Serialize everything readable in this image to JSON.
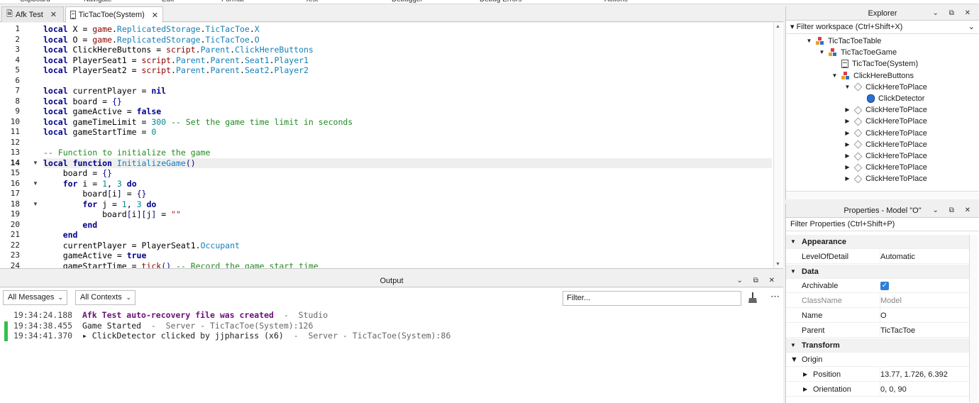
{
  "ribbon": [
    "Clipboard",
    "Navigate",
    "Edit",
    "Format",
    "Test",
    "Debugger",
    "Debug Errors",
    "Actions"
  ],
  "tabs": [
    {
      "label": "Afk Test",
      "active": false,
      "icon": "place-icon"
    },
    {
      "label": "TicTacToe(System)",
      "active": true,
      "icon": "script-icon"
    }
  ],
  "editor": {
    "current_line": 14,
    "line_numbers": [
      "1",
      "2",
      "3",
      "4",
      "5",
      "6",
      "7",
      "8",
      "9",
      "10",
      "11",
      "12",
      "13",
      "14",
      "15",
      "16",
      "17",
      "18",
      "19",
      "20",
      "21",
      "22",
      "23",
      "24"
    ],
    "lines": [
      "local X = game.ReplicatedStorage.TicTacToe.X",
      "local O = game.ReplicatedStorage.TicTacToe.O",
      "local ClickHereButtons = script.Parent.ClickHereButtons",
      "local PlayerSeat1 = script.Parent.Parent.Seat1.Player1",
      "local PlayerSeat2 = script.Parent.Parent.Seat2.Player2",
      "",
      "local currentPlayer = nil",
      "local board = {}",
      "local gameActive = false",
      "local gameTimeLimit = 300 -- Set the game time limit in seconds",
      "local gameStartTime = 0",
      "",
      "-- Function to initialize the game",
      "local function InitializeGame()",
      "    board = {}",
      "    for i = 1, 3 do",
      "        board[i] = {}",
      "        for j = 1, 3 do",
      "            board[i][j] = \"\"",
      "        end",
      "    end",
      "    currentPlayer = PlayerSeat1.Occupant",
      "    gameActive = true",
      "    gameStartTime = tick() -- Record the game start time"
    ]
  },
  "output": {
    "title": "Output",
    "messages_filter": "All Messages",
    "contexts_filter": "All Contexts",
    "filter_placeholder": "Filter...",
    "logs": [
      {
        "time": "19:34:24.188",
        "text": "Afk Test auto-recovery file was created",
        "sep": "  -  ",
        "source": "Studio"
      },
      {
        "time": "19:34:38.455",
        "text": "Game Started",
        "sep": "  -  ",
        "source": "Server - TicTacToe(System):126"
      },
      {
        "time": "19:34:41.370",
        "text": "▸ ClickDetector clicked by jjphariss (x6)",
        "sep": "  -  ",
        "source": "Server - TicTacToe(System):86"
      }
    ]
  },
  "explorer": {
    "title": "Explorer",
    "filter_placeholder": "Filter workspace (Ctrl+Shift+X)",
    "items": [
      {
        "label": "TicTacToeTable",
        "icon": "model-icon",
        "expand": "open"
      },
      {
        "label": "TicTacToeGame",
        "icon": "model-icon",
        "expand": "open"
      },
      {
        "label": "TicTacToe(System)",
        "icon": "script-icon",
        "expand": "none"
      },
      {
        "label": "ClickHereButtons",
        "icon": "model-icon",
        "expand": "open"
      },
      {
        "label": "ClickHereToPlace",
        "icon": "part-icon",
        "expand": "open"
      },
      {
        "label": "ClickDetector",
        "icon": "click-detector-icon",
        "expand": "none"
      },
      {
        "label": "ClickHereToPlace",
        "icon": "part-icon",
        "expand": "closed"
      },
      {
        "label": "ClickHereToPlace",
        "icon": "part-icon",
        "expand": "closed"
      },
      {
        "label": "ClickHereToPlace",
        "icon": "part-icon",
        "expand": "closed"
      },
      {
        "label": "ClickHereToPlace",
        "icon": "part-icon",
        "expand": "closed"
      },
      {
        "label": "ClickHereToPlace",
        "icon": "part-icon",
        "expand": "closed"
      },
      {
        "label": "ClickHereToPlace",
        "icon": "part-icon",
        "expand": "closed"
      },
      {
        "label": "ClickHereToPlace",
        "icon": "part-icon",
        "expand": "closed"
      }
    ]
  },
  "properties": {
    "title": "Properties - Model \"O\"",
    "filter_placeholder": "Filter Properties (Ctrl+Shift+P)",
    "rows": [
      {
        "kind": "cat",
        "name": "Appearance"
      },
      {
        "kind": "prop",
        "name": "LevelOfDetail",
        "value": "Automatic"
      },
      {
        "kind": "cat",
        "name": "Data"
      },
      {
        "kind": "check",
        "name": "Archivable",
        "value": "true"
      },
      {
        "kind": "dim",
        "name": "ClassName",
        "value": "Model"
      },
      {
        "kind": "prop",
        "name": "Name",
        "value": "O"
      },
      {
        "kind": "prop",
        "name": "Parent",
        "value": "TicTacToe"
      },
      {
        "kind": "cat",
        "name": "Transform"
      },
      {
        "kind": "open",
        "name": "Origin",
        "value": ""
      },
      {
        "kind": "sub",
        "name": "Position",
        "value": "13.77, 1.726, 6.392"
      },
      {
        "kind": "sub",
        "name": "Orientation",
        "value": "0, 0, 90"
      }
    ]
  },
  "colors": {
    "keyword": "#00008b",
    "accent": "#2f7fd8",
    "status_ok": "#35c04a"
  }
}
